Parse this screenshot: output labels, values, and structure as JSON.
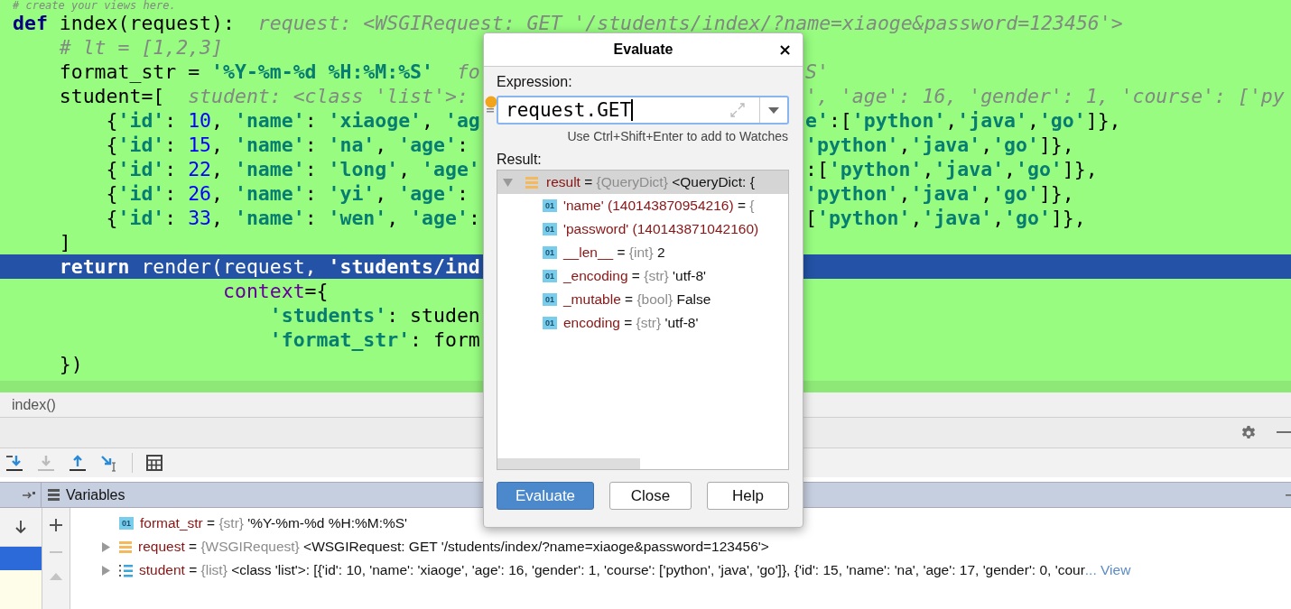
{
  "editor": {
    "lines": [
      {
        "current": false,
        "left": [
          {
            "kind": "comment",
            "text": "# create your views here."
          }
        ]
      },
      {
        "current": false,
        "left": [
          {
            "kind": "kw",
            "text": "def"
          },
          {
            "kind": "plain",
            "text": " index(request):  "
          },
          {
            "kind": "hint",
            "text": "request: <WSGIRequest: GET '/students/index/?name=xiaoge&password=123456'>"
          }
        ]
      },
      {
        "current": false,
        "left": [
          {
            "kind": "comment",
            "text": "    # lt = [1,2,3]"
          }
        ]
      },
      {
        "current": false,
        "left": [
          {
            "kind": "plain",
            "text": "    format_str = "
          },
          {
            "kind": "str",
            "text": "'%Y-%m-%d %H:%M:%S'"
          },
          {
            "kind": "hint",
            "text": "  fo"
          }
        ],
        "right": [
          {
            "kind": "hint",
            "text": "S'"
          }
        ]
      },
      {
        "current": false,
        "left": [
          {
            "kind": "plain",
            "text": "    student=[  "
          },
          {
            "kind": "hint",
            "text": "student: <class 'list'>:"
          }
        ],
        "right": [
          {
            "kind": "hint",
            "text": "', 'age': 16, 'gender': 1, 'course': ['py"
          }
        ]
      },
      {
        "current": false,
        "left": [
          {
            "kind": "plain",
            "text": "        {"
          },
          {
            "kind": "str",
            "text": "'id'"
          },
          {
            "kind": "plain",
            "text": ": "
          },
          {
            "kind": "num",
            "text": "10"
          },
          {
            "kind": "plain",
            "text": ", "
          },
          {
            "kind": "str",
            "text": "'name'"
          },
          {
            "kind": "plain",
            "text": ": "
          },
          {
            "kind": "str",
            "text": "'xiaoge'"
          },
          {
            "kind": "plain",
            "text": ", "
          },
          {
            "kind": "str",
            "text": "'ag"
          }
        ],
        "right": [
          {
            "kind": "str",
            "text": "e'"
          },
          {
            "kind": "plain",
            "text": ":["
          },
          {
            "kind": "str",
            "text": "'python'"
          },
          {
            "kind": "plain",
            "text": ","
          },
          {
            "kind": "str",
            "text": "'java'"
          },
          {
            "kind": "plain",
            "text": ","
          },
          {
            "kind": "str",
            "text": "'go'"
          },
          {
            "kind": "plain",
            "text": "]},"
          }
        ]
      },
      {
        "current": false,
        "left": [
          {
            "kind": "plain",
            "text": "        {"
          },
          {
            "kind": "str",
            "text": "'id'"
          },
          {
            "kind": "plain",
            "text": ": "
          },
          {
            "kind": "num",
            "text": "15"
          },
          {
            "kind": "plain",
            "text": ", "
          },
          {
            "kind": "str",
            "text": "'name'"
          },
          {
            "kind": "plain",
            "text": ": "
          },
          {
            "kind": "str",
            "text": "'na'"
          },
          {
            "kind": "plain",
            "text": ", "
          },
          {
            "kind": "str",
            "text": "'age'"
          },
          {
            "kind": "plain",
            "text": ":"
          }
        ],
        "right": [
          {
            "kind": "str",
            "text": "'python'"
          },
          {
            "kind": "plain",
            "text": ","
          },
          {
            "kind": "str",
            "text": "'java'"
          },
          {
            "kind": "plain",
            "text": ","
          },
          {
            "kind": "str",
            "text": "'go'"
          },
          {
            "kind": "plain",
            "text": "]},"
          }
        ]
      },
      {
        "current": false,
        "left": [
          {
            "kind": "plain",
            "text": "        {"
          },
          {
            "kind": "str",
            "text": "'id'"
          },
          {
            "kind": "plain",
            "text": ": "
          },
          {
            "kind": "num",
            "text": "22"
          },
          {
            "kind": "plain",
            "text": ", "
          },
          {
            "kind": "str",
            "text": "'name'"
          },
          {
            "kind": "plain",
            "text": ": "
          },
          {
            "kind": "str",
            "text": "'long'"
          },
          {
            "kind": "plain",
            "text": ", "
          },
          {
            "kind": "str",
            "text": "'age'"
          }
        ],
        "right": [
          {
            "kind": "plain",
            "text": ":["
          },
          {
            "kind": "str",
            "text": "'python'"
          },
          {
            "kind": "plain",
            "text": ","
          },
          {
            "kind": "str",
            "text": "'java'"
          },
          {
            "kind": "plain",
            "text": ","
          },
          {
            "kind": "str",
            "text": "'go'"
          },
          {
            "kind": "plain",
            "text": "]},"
          }
        ]
      },
      {
        "current": false,
        "left": [
          {
            "kind": "plain",
            "text": "        {"
          },
          {
            "kind": "str",
            "text": "'id'"
          },
          {
            "kind": "plain",
            "text": ": "
          },
          {
            "kind": "num",
            "text": "26"
          },
          {
            "kind": "plain",
            "text": ", "
          },
          {
            "kind": "str",
            "text": "'name'"
          },
          {
            "kind": "plain",
            "text": ": "
          },
          {
            "kind": "str",
            "text": "'yi'"
          },
          {
            "kind": "plain",
            "text": ", "
          },
          {
            "kind": "str",
            "text": "'age'"
          },
          {
            "kind": "plain",
            "text": ":"
          }
        ],
        "right": [
          {
            "kind": "str",
            "text": "'python'"
          },
          {
            "kind": "plain",
            "text": ","
          },
          {
            "kind": "str",
            "text": "'java'"
          },
          {
            "kind": "plain",
            "text": ","
          },
          {
            "kind": "str",
            "text": "'go'"
          },
          {
            "kind": "plain",
            "text": "]},"
          }
        ]
      },
      {
        "current": false,
        "left": [
          {
            "kind": "plain",
            "text": "        {"
          },
          {
            "kind": "str",
            "text": "'id'"
          },
          {
            "kind": "plain",
            "text": ": "
          },
          {
            "kind": "num",
            "text": "33"
          },
          {
            "kind": "plain",
            "text": ", "
          },
          {
            "kind": "str",
            "text": "'name'"
          },
          {
            "kind": "plain",
            "text": ": "
          },
          {
            "kind": "str",
            "text": "'wen'"
          },
          {
            "kind": "plain",
            "text": ", "
          },
          {
            "kind": "str",
            "text": "'age'"
          },
          {
            "kind": "plain",
            "text": ":"
          }
        ],
        "right": [
          {
            "kind": "plain",
            "text": "["
          },
          {
            "kind": "str",
            "text": "'python'"
          },
          {
            "kind": "plain",
            "text": ","
          },
          {
            "kind": "str",
            "text": "'java'"
          },
          {
            "kind": "plain",
            "text": ","
          },
          {
            "kind": "str",
            "text": "'go'"
          },
          {
            "kind": "plain",
            "text": "]},"
          }
        ]
      },
      {
        "current": false,
        "left": [
          {
            "kind": "plain",
            "text": "    ]"
          }
        ]
      },
      {
        "current": true,
        "left": [
          {
            "kind": "kw",
            "text": "    return"
          },
          {
            "kind": "plain",
            "text": " render(request, "
          },
          {
            "kind": "str",
            "text": "'students/ind"
          }
        ]
      },
      {
        "current": false,
        "left": [
          {
            "kind": "param",
            "text": "                  context"
          },
          {
            "kind": "plain",
            "text": "={"
          }
        ]
      },
      {
        "current": false,
        "left": [
          {
            "kind": "str",
            "text": "                      'students'"
          },
          {
            "kind": "plain",
            "text": ": studen"
          }
        ]
      },
      {
        "current": false,
        "left": [
          {
            "kind": "str",
            "text": "                      'format_str'"
          },
          {
            "kind": "plain",
            "text": ": form"
          }
        ]
      },
      {
        "current": false,
        "left": [
          {
            "kind": "plain",
            "text": "    })"
          }
        ]
      }
    ]
  },
  "breadcrumb": "index()",
  "variables": {
    "title": "Variables",
    "frames": [
      {
        "selected": true
      }
    ],
    "rows": [
      {
        "kind": "str",
        "expandable": false,
        "badge": "01",
        "name": "format_str",
        "eq": "=",
        "type": "{str}",
        "value": "'%Y-%m-%d %H:%M:%S'"
      },
      {
        "kind": "object",
        "expandable": true,
        "name": "request",
        "eq": "=",
        "type": "{WSGIRequest}",
        "value": "<WSGIRequest: GET '/students/index/?name=xiaoge&password=123456'>"
      },
      {
        "kind": "list",
        "expandable": true,
        "name": "student",
        "eq": "=",
        "type": "{list}",
        "value": "<class 'list'>: [{'id': 10, 'name': 'xiaoge', 'age': 16, 'gender': 1, 'course': ['python', 'java', 'go']}, {'id': 15, 'name': 'na', 'age': 17, 'gender': 0, 'cour",
        "more": "... View"
      }
    ]
  },
  "dialog": {
    "title": "Evaluate",
    "close": "×",
    "expression_label": "Expression:",
    "expression": "request.GET",
    "hint": "Use Ctrl+Shift+Enter to add to Watches",
    "result_label": "Result:",
    "tree": [
      {
        "kind": "object",
        "expanded": true,
        "selected": true,
        "name": "result",
        "eq": "=",
        "type": "{QueryDict}",
        "value": "<QueryDict: {",
        "children": [
          {
            "kind": "value",
            "badge": "01",
            "name": "'name' (140143870954216)",
            "eq": "=",
            "type": "{"
          },
          {
            "kind": "value",
            "badge": "01",
            "name": "'password' (140143871042160)"
          },
          {
            "kind": "value",
            "badge": "01",
            "name": "__len__",
            "eq": "=",
            "type": "{int}",
            "value": "2"
          },
          {
            "kind": "value",
            "badge": "01",
            "name": "_encoding",
            "eq": "=",
            "type": "{str}",
            "value": "'utf-8'"
          },
          {
            "kind": "value",
            "badge": "01",
            "name": "_mutable",
            "eq": "=",
            "type": "{bool}",
            "value": "False"
          },
          {
            "kind": "value",
            "badge": "01",
            "name": "encoding",
            "eq": "=",
            "type": "{str}",
            "value": "'utf-8'"
          }
        ]
      }
    ],
    "buttons": [
      {
        "label": "Evaluate",
        "default": true
      },
      {
        "label": "Close",
        "default": false
      },
      {
        "label": "Help",
        "default": false
      }
    ]
  }
}
